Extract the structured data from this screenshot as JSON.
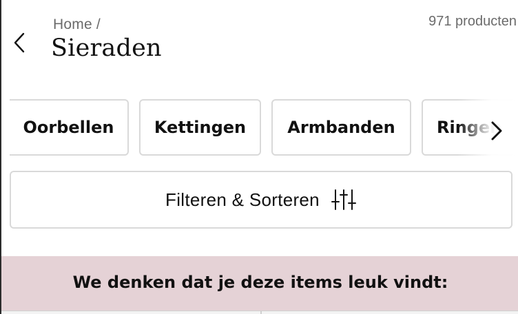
{
  "header": {
    "breadcrumb": {
      "home": "Home",
      "separator": "/"
    },
    "title": "Sieraden",
    "product_count": "971 producten"
  },
  "categories": [
    {
      "label": "Oorbellen"
    },
    {
      "label": "Kettingen"
    },
    {
      "label": "Armbanden"
    },
    {
      "label": "Ringen"
    }
  ],
  "filter": {
    "label": "Filteren & Sorteren"
  },
  "recommendations": {
    "title": "We denken dat je deze items leuk vindt:"
  },
  "icons": {
    "back": "chevron-left-icon",
    "next": "chevron-right-icon",
    "filter": "sliders-icon"
  },
  "colors": {
    "banner": "#e5d2d6",
    "chip_border": "#d9d9d9",
    "muted_text": "#6b6b6b"
  }
}
